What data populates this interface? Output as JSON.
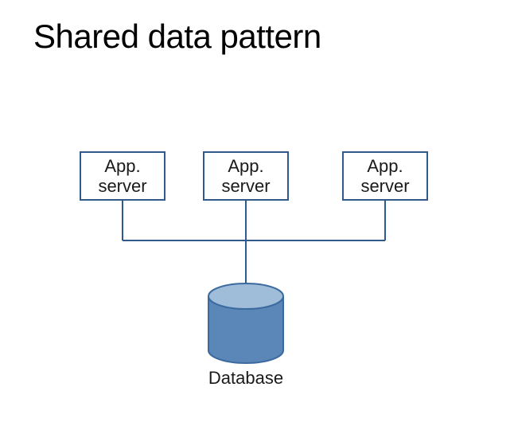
{
  "title": "Shared data pattern",
  "nodes": {
    "app1": {
      "label": "App.\nserver"
    },
    "app2": {
      "label": "App.\nserver"
    },
    "app3": {
      "label": "App.\nserver"
    },
    "db": {
      "label": "Database"
    }
  },
  "colors": {
    "boxBorder": "#2f5a8b",
    "line": "#2f5a8b",
    "cylinderFill": "#5a86b8",
    "cylinderTop": "#9fbcd9",
    "cylinderStroke": "#3b6a9f"
  }
}
